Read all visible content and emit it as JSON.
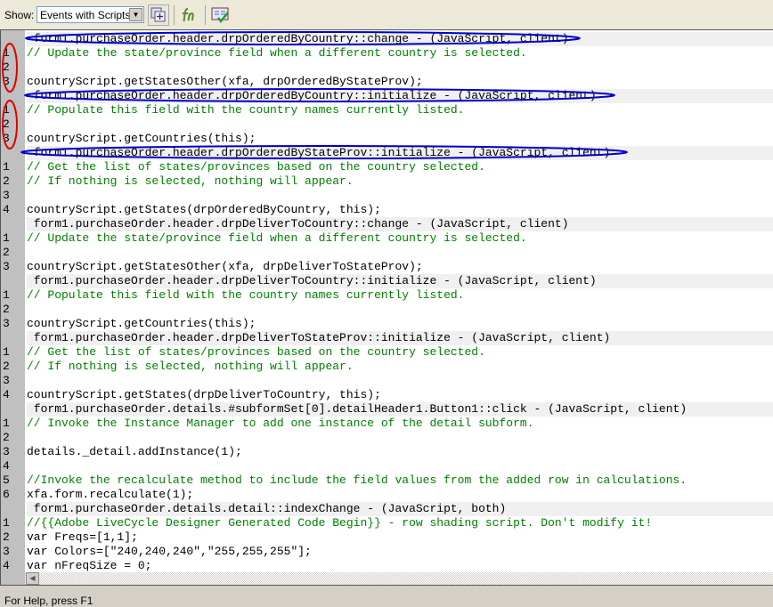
{
  "toolbar": {
    "show_label": "Show:",
    "show_select_value": "Events with Scripts",
    "icons": [
      "show-events-for-child-objects-icon",
      "functions-icon",
      "check-script-syntax-icon"
    ]
  },
  "editor": {
    "lines": [
      {
        "num": "",
        "type": "header",
        "text": " form1.purchaseOrder.header.drpOrderedByCountry::change - (JavaScript, client)"
      },
      {
        "num": "1",
        "type": "comment",
        "text": "// Update the state/province field when a different country is selected."
      },
      {
        "num": "2",
        "type": "code",
        "text": ""
      },
      {
        "num": "3",
        "type": "code",
        "text": "countryScript.getStatesOther(xfa, drpOrderedByStateProv);"
      },
      {
        "num": "",
        "type": "header",
        "text": " form1.purchaseOrder.header.drpOrderedByCountry::initialize - (JavaScript, client)"
      },
      {
        "num": "1",
        "type": "comment",
        "text": "// Populate this field with the country names currently listed."
      },
      {
        "num": "2",
        "type": "code",
        "text": ""
      },
      {
        "num": "3",
        "type": "code",
        "text": "countryScript.getCountries(this);"
      },
      {
        "num": "",
        "type": "header",
        "text": " form1.purchaseOrder.header.drpOrderedByStateProv::initialize - (JavaScript, client)"
      },
      {
        "num": "1",
        "type": "comment",
        "text": "// Get the list of states/provinces based on the country selected."
      },
      {
        "num": "2",
        "type": "comment",
        "text": "// If nothing is selected, nothing will appear."
      },
      {
        "num": "3",
        "type": "code",
        "text": ""
      },
      {
        "num": "4",
        "type": "code",
        "text": "countryScript.getStates(drpOrderedByCountry, this);"
      },
      {
        "num": "",
        "type": "header",
        "text": " form1.purchaseOrder.header.drpDeliverToCountry::change - (JavaScript, client)"
      },
      {
        "num": "1",
        "type": "comment",
        "text": "// Update the state/province field when a different country is selected."
      },
      {
        "num": "2",
        "type": "code",
        "text": ""
      },
      {
        "num": "3",
        "type": "code",
        "text": "countryScript.getStatesOther(xfa, drpDeliverToStateProv);"
      },
      {
        "num": "",
        "type": "header",
        "text": " form1.purchaseOrder.header.drpDeliverToCountry::initialize - (JavaScript, client)"
      },
      {
        "num": "1",
        "type": "comment",
        "text": "// Populate this field with the country names currently listed."
      },
      {
        "num": "2",
        "type": "code",
        "text": ""
      },
      {
        "num": "3",
        "type": "code",
        "text": "countryScript.getCountries(this);"
      },
      {
        "num": "",
        "type": "header",
        "text": " form1.purchaseOrder.header.drpDeliverToStateProv::initialize - (JavaScript, client)"
      },
      {
        "num": "1",
        "type": "comment",
        "text": "// Get the list of states/provinces based on the country selected."
      },
      {
        "num": "2",
        "type": "comment",
        "text": "// If nothing is selected, nothing will appear."
      },
      {
        "num": "3",
        "type": "code",
        "text": ""
      },
      {
        "num": "4",
        "type": "code",
        "text": "countryScript.getStates(drpDeliverToCountry, this);"
      },
      {
        "num": "",
        "type": "header",
        "text": " form1.purchaseOrder.details.#subformSet[0].detailHeader1.Button1::click - (JavaScript, client)"
      },
      {
        "num": "1",
        "type": "comment",
        "text": "// Invoke the Instance Manager to add one instance of the detail subform."
      },
      {
        "num": "2",
        "type": "code",
        "text": ""
      },
      {
        "num": "3",
        "type": "code",
        "text": "details._detail.addInstance(1);"
      },
      {
        "num": "4",
        "type": "code",
        "text": ""
      },
      {
        "num": "5",
        "type": "comment",
        "text": "//Invoke the recalculate method to include the field values from the added row in calculations."
      },
      {
        "num": "6",
        "type": "code",
        "text": "xfa.form.recalculate(1);"
      },
      {
        "num": "",
        "type": "header",
        "text": " form1.purchaseOrder.details.detail::indexChange - (JavaScript, both)"
      },
      {
        "num": "1",
        "type": "comment",
        "text": "//{{Adobe LiveCycle Designer Generated Code Begin}} - row shading script. Don't modify it!"
      },
      {
        "num": "2",
        "type": "code",
        "text": "var Freqs=[1,1];"
      },
      {
        "num": "3",
        "type": "code",
        "text": "var Colors=[\"240,240,240\",\"255,255,255\"];"
      },
      {
        "num": "4",
        "type": "code",
        "text": "var nFreqSize = 0;"
      }
    ]
  },
  "status_bar": {
    "text": "For Help, press F1"
  },
  "colors": {
    "comment": "#008000",
    "keyword": "#0000ff",
    "header_bg": "#f0f0f0",
    "gutter": "#c0c0c0",
    "annotation_blue": "#0000cc",
    "annotation_red": "#dd0000"
  }
}
